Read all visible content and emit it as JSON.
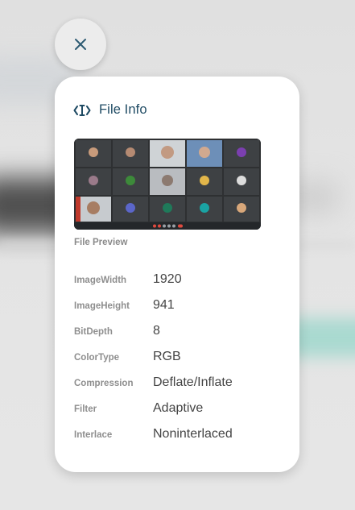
{
  "header": {
    "title": "File Info",
    "icon": "code-cursor-icon"
  },
  "close_button": {
    "icon": "close-icon"
  },
  "preview": {
    "label": "File Preview"
  },
  "info": [
    {
      "key": "ImageWidth",
      "value": "1920"
    },
    {
      "key": "ImageHeight",
      "value": "941"
    },
    {
      "key": "BitDepth",
      "value": "8"
    },
    {
      "key": "ColorType",
      "value": "RGB"
    },
    {
      "key": "Compression",
      "value": "Deflate/Inflate"
    },
    {
      "key": "Filter",
      "value": "Adaptive"
    },
    {
      "key": "Interlace",
      "value": "Noninterlaced"
    }
  ],
  "colors": {
    "accent": "#1e4a63",
    "card_bg": "#ffffff",
    "muted_label": "#8e8e8e",
    "value_text": "#444444"
  }
}
